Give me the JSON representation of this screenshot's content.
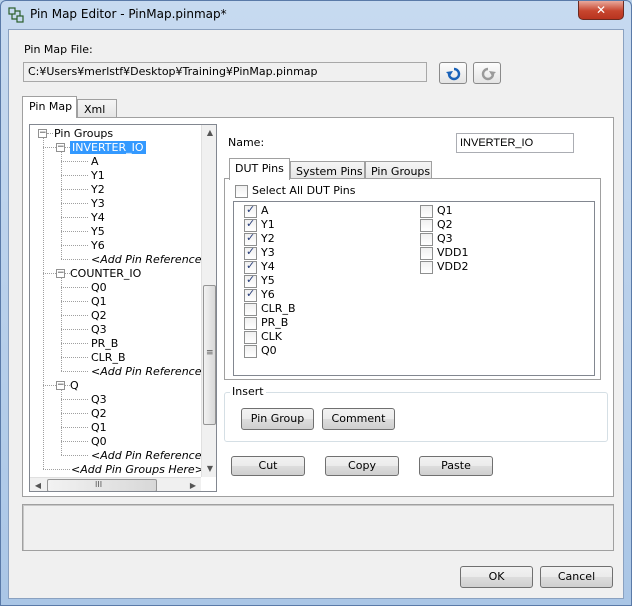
{
  "window": {
    "title": "Pin Map Editor - PinMap.pinmap*",
    "close_glyph": "✕",
    "icon": "app-grid-icon"
  },
  "file": {
    "label": "Pin Map File:",
    "path": "C:¥Users¥merlstf¥Desktop¥Training¥PinMap.pinmap",
    "undo_icon": "undo-icon",
    "redo_icon": "redo-icon"
  },
  "outer_tabs": [
    "Pin Map",
    "Xml"
  ],
  "tree": {
    "root": "Pin Groups",
    "groups": [
      {
        "name": "INVERTER_IO",
        "selected": true,
        "pins": [
          "A",
          "Y1",
          "Y2",
          "Y3",
          "Y4",
          "Y5",
          "Y6"
        ],
        "add_label": "<Add Pin References Here>"
      },
      {
        "name": "COUNTER_IO",
        "selected": false,
        "pins": [
          "Q0",
          "Q1",
          "Q2",
          "Q3",
          "PR_B",
          "CLR_B"
        ],
        "add_label": "<Add Pin References Here>"
      },
      {
        "name": "Q",
        "selected": false,
        "pins": [
          "Q3",
          "Q2",
          "Q1",
          "Q0"
        ],
        "add_label": "<Add Pin References Here>"
      }
    ],
    "add_groups_label": "<Add Pin Groups Here>",
    "scroll_glyphs": {
      "up": "▲",
      "down": "▼",
      "left": "◀",
      "right": "▶",
      "thumb_grip": "≡",
      "hthumb_grip": "III"
    }
  },
  "name_field": {
    "label": "Name:",
    "value": "INVERTER_IO"
  },
  "inner_tabs": [
    "DUT Pins",
    "System Pins",
    "Pin Groups"
  ],
  "select_all": {
    "label": "Select All DUT Pins",
    "checked": false
  },
  "pins_col1": [
    {
      "label": "A",
      "checked": true
    },
    {
      "label": "Y1",
      "checked": true
    },
    {
      "label": "Y2",
      "checked": true
    },
    {
      "label": "Y3",
      "checked": true
    },
    {
      "label": "Y4",
      "checked": true
    },
    {
      "label": "Y5",
      "checked": true
    },
    {
      "label": "Y6",
      "checked": true
    },
    {
      "label": "CLR_B",
      "checked": false
    },
    {
      "label": "PR_B",
      "checked": false
    },
    {
      "label": "CLK",
      "checked": false
    },
    {
      "label": "Q0",
      "checked": false
    }
  ],
  "pins_col2": [
    {
      "label": "Q1",
      "checked": false
    },
    {
      "label": "Q2",
      "checked": false
    },
    {
      "label": "Q3",
      "checked": false
    },
    {
      "label": "VDD1",
      "checked": false
    },
    {
      "label": "VDD2",
      "checked": false
    }
  ],
  "insert": {
    "title": "Insert",
    "pin_group": "Pin Group",
    "comment": "Comment"
  },
  "edit": {
    "cut": "Cut",
    "copy": "Copy",
    "paste": "Paste"
  },
  "footer": {
    "ok": "OK",
    "cancel": "Cancel"
  }
}
